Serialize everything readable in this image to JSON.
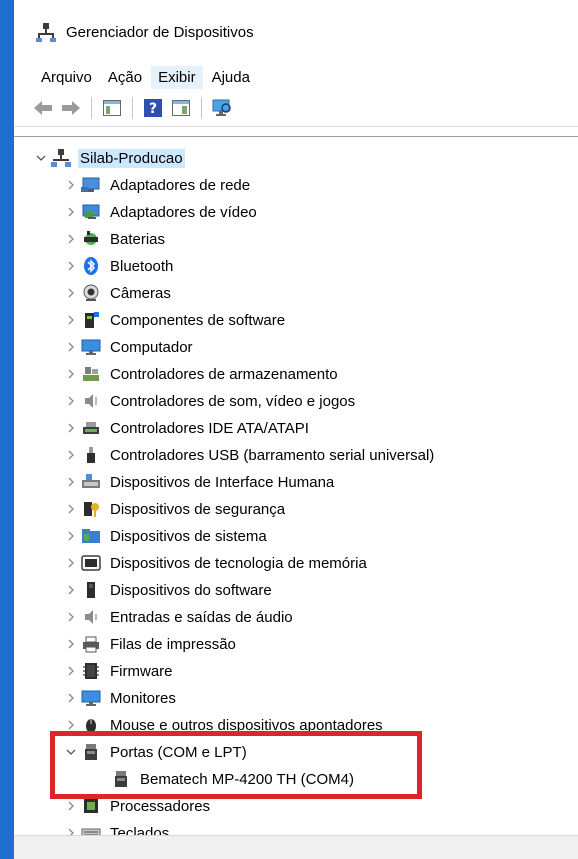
{
  "title": "Gerenciador de Dispositivos",
  "menu": [
    "Arquivo",
    "Ação",
    "Exibir",
    "Ajuda"
  ],
  "active_menu_index": 2,
  "colors": {
    "highlight": "#e0242d",
    "selection": "#cce8ff",
    "desktop": "#1e6fd0"
  },
  "tree": {
    "root": {
      "label": "Silab-Producao",
      "icon": "computer-network-icon",
      "expanded": true
    },
    "categories": [
      {
        "label": "Adaptadores de rede",
        "icon": "network-adapter-icon"
      },
      {
        "label": "Adaptadores de vídeo",
        "icon": "display-adapter-icon"
      },
      {
        "label": "Baterias",
        "icon": "battery-icon"
      },
      {
        "label": "Bluetooth",
        "icon": "bluetooth-icon"
      },
      {
        "label": "Câmeras",
        "icon": "camera-icon"
      },
      {
        "label": "Componentes de software",
        "icon": "software-component-icon"
      },
      {
        "label": "Computador",
        "icon": "monitor-icon"
      },
      {
        "label": "Controladores de armazenamento",
        "icon": "storage-controller-icon"
      },
      {
        "label": "Controladores de som, vídeo e jogos",
        "icon": "speaker-icon"
      },
      {
        "label": "Controladores IDE ATA/ATAPI",
        "icon": "ide-controller-icon"
      },
      {
        "label": "Controladores USB (barramento serial universal)",
        "icon": "usb-icon"
      },
      {
        "label": "Dispositivos de Interface Humana",
        "icon": "hid-icon"
      },
      {
        "label": "Dispositivos de segurança",
        "icon": "security-key-icon"
      },
      {
        "label": "Dispositivos de sistema",
        "icon": "system-folder-icon"
      },
      {
        "label": "Dispositivos de tecnologia de memória",
        "icon": "memory-icon"
      },
      {
        "label": "Dispositivos do software",
        "icon": "software-device-icon"
      },
      {
        "label": "Entradas e saídas de áudio",
        "icon": "audio-io-icon"
      },
      {
        "label": "Filas de impressão",
        "icon": "printer-icon"
      },
      {
        "label": "Firmware",
        "icon": "firmware-chip-icon"
      },
      {
        "label": "Monitores",
        "icon": "monitor-icon"
      },
      {
        "label": "Mouse e outros dispositivos apontadores",
        "icon": "mouse-icon"
      },
      {
        "label": "Portas (COM e LPT)",
        "icon": "port-icon",
        "expanded": true,
        "children": [
          {
            "label": "Bematech MP-4200 TH (COM4)",
            "icon": "port-icon"
          }
        ]
      },
      {
        "label": "Processadores",
        "icon": "processor-icon"
      },
      {
        "label": "Teclados",
        "icon": "keyboard-icon"
      }
    ]
  }
}
